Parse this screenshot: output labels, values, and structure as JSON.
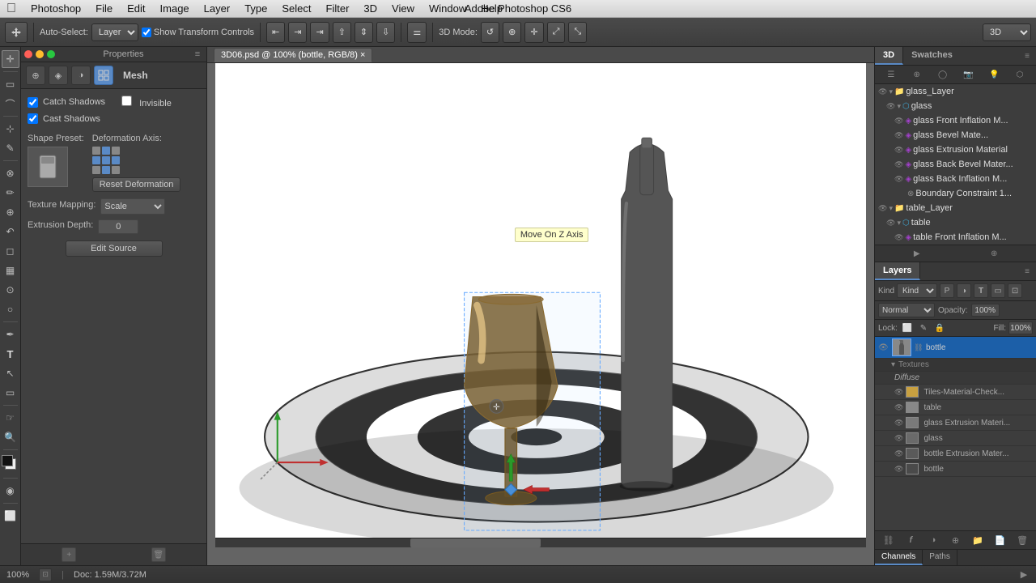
{
  "menubar": {
    "apple": "⌘",
    "items": [
      "Photoshop",
      "File",
      "Edit",
      "Image",
      "Layer",
      "Type",
      "Select",
      "Filter",
      "3D",
      "View",
      "Window",
      "Help"
    ],
    "title": "Adobe Photoshop CS6"
  },
  "toolbar": {
    "auto_select_label": "Auto-Select:",
    "layer_label": "Layer",
    "show_transform": "Show Transform Controls",
    "3d_mode": "3D Mode:",
    "3d_value": "3D"
  },
  "doc_tab": {
    "title": "3D06.psd @ 100% (bottle, RGB/8)",
    "modified": true
  },
  "properties_panel": {
    "title": "Properties",
    "mesh_label": "Mesh",
    "catch_shadows": "Catch Shadows",
    "invisible": "Invisible",
    "cast_shadows": "Cast Shadows",
    "shape_preset_label": "Shape Preset:",
    "deformation_label": "Deformation Axis:",
    "reset_deformation": "Reset Deformation",
    "texture_mapping_label": "Texture Mapping:",
    "texture_mapping_value": "Scale",
    "extrusion_depth_label": "Extrusion Depth:",
    "extrusion_depth_value": "0",
    "edit_source": "Edit Source"
  },
  "panel_3d": {
    "header": "3D",
    "swatches_header": "Swatches",
    "layer_tree": [
      {
        "id": "glass_layer",
        "label": "glass_Layer",
        "type": "folder",
        "level": 0,
        "expanded": true
      },
      {
        "id": "glass",
        "label": "glass",
        "type": "mesh",
        "level": 1,
        "expanded": true
      },
      {
        "id": "glass_front_inflation",
        "label": "glass Front Inflation M...",
        "type": "material",
        "level": 2
      },
      {
        "id": "glass_bevel_material",
        "label": "glass Bevel Mate...",
        "type": "material",
        "level": 2
      },
      {
        "id": "glass_extrusion_material",
        "label": "glass Extrusion Material",
        "type": "material",
        "level": 2
      },
      {
        "id": "glass_back_bevel",
        "label": "glass Back Bevel Mater...",
        "type": "material",
        "level": 2
      },
      {
        "id": "glass_back_inflation",
        "label": "glass Back Inflation M...",
        "type": "material",
        "level": 2
      },
      {
        "id": "boundary_constraint",
        "label": "Boundary Constraint 1...",
        "type": "constraint",
        "level": 2
      },
      {
        "id": "table_layer",
        "label": "table_Layer",
        "type": "folder",
        "level": 0,
        "expanded": true
      },
      {
        "id": "table",
        "label": "table",
        "type": "mesh",
        "level": 1,
        "expanded": false
      },
      {
        "id": "table_front_inflation",
        "label": "table Front Inflation M...",
        "type": "material",
        "level": 2
      }
    ]
  },
  "layers_panel": {
    "header": "Layers",
    "blend_mode": "Normal",
    "opacity_label": "Opacity:",
    "opacity_value": "100%",
    "lock_label": "Lock:",
    "fill_label": "Fill:",
    "fill_value": "100%",
    "layers": [
      {
        "id": "bottle_layer",
        "name": "bottle",
        "type": "3d",
        "visible": true,
        "selected": true,
        "sub_expanded": true,
        "sub_items": [
          {
            "label": "Textures",
            "is_header": true
          },
          {
            "label": "Diffuse",
            "is_section": true
          },
          {
            "label": "Tiles-Material-Check...",
            "type": "texture"
          },
          {
            "label": "table",
            "type": "texture"
          },
          {
            "label": "glass Extrusion Materi...",
            "type": "texture"
          },
          {
            "label": "glass",
            "type": "texture"
          },
          {
            "label": "bottle Extrusion Mater...",
            "type": "texture"
          },
          {
            "label": "bottle",
            "type": "texture"
          }
        ]
      }
    ],
    "bottom_tabs": [
      "Channels",
      "Paths"
    ],
    "bottom_icons": [
      "link",
      "fx",
      "circle-half",
      "trash",
      "folder",
      "new-layer",
      "delete"
    ]
  },
  "canvas": {
    "zoom": "100%",
    "doc_info": "Doc: 1.59M/3.72M"
  },
  "tooltip": {
    "text": "Move On Z Axis"
  },
  "status_bar": {
    "zoom": "100%",
    "doc": "Doc: 1.59M/3.72M"
  }
}
